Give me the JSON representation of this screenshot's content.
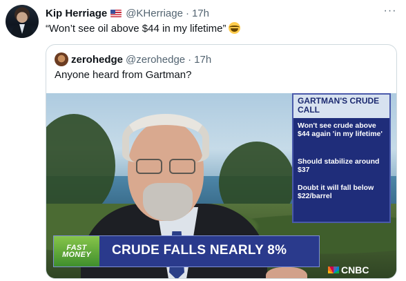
{
  "tweet": {
    "author_name": "Kip Herriage",
    "handle": "@KHerriage",
    "separator": "·",
    "time": "17h",
    "text": "“Won’t see oil above $44 in my lifetime”",
    "more_label": "···"
  },
  "quote": {
    "author_name": "zerohedge",
    "handle": "@zerohedge",
    "separator": "·",
    "time": "17h",
    "text": "Anyone heard from Gartman?"
  },
  "media": {
    "panel_title": "GARTMAN'S CRUDE CALL",
    "panel_items": [
      "Won't see crude above $44 again 'in my lifetime'",
      "Should stabilize around $37",
      "Doubt it will fall below $22/barrel"
    ],
    "badge": "FAST MONEY",
    "headline": "CRUDE FALLS NEARLY 8%",
    "network": "CNBC"
  },
  "colors": {
    "text_primary": "#0f1419",
    "text_secondary": "#536471",
    "border": "#cfd9de",
    "lower_third": "#2a3a8c",
    "panel": "#1f2d7a"
  }
}
